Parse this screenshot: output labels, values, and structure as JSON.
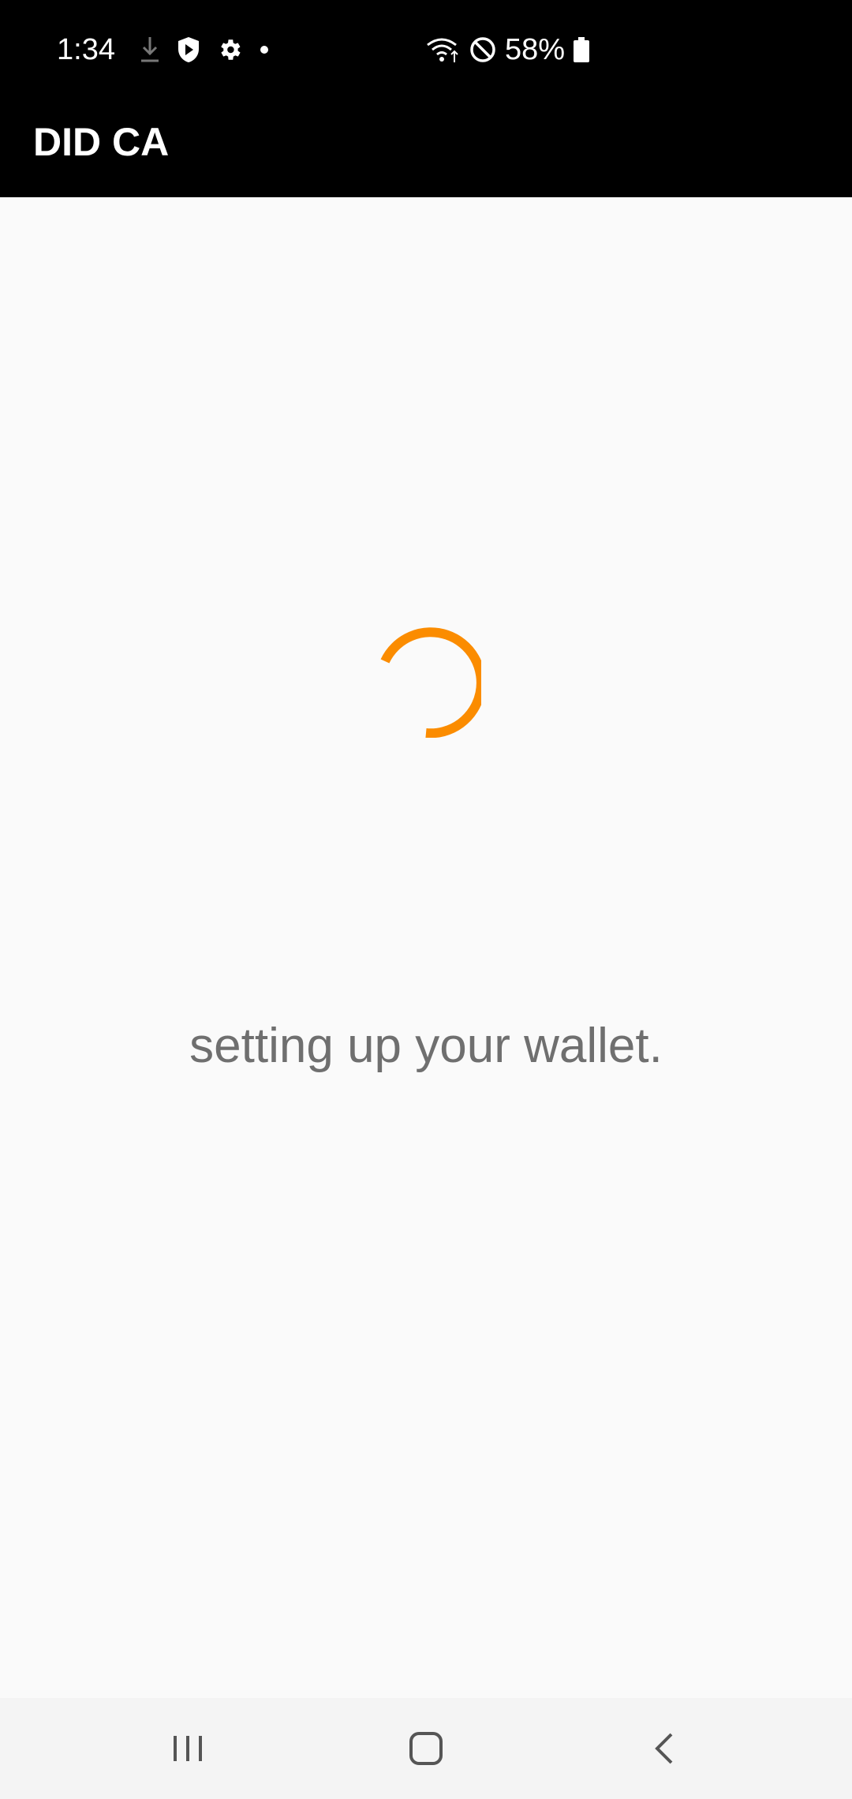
{
  "status_bar": {
    "time": "1:34",
    "battery_percent": "58%",
    "icons_left": [
      "download-icon",
      "shield-play-icon",
      "gear-icon",
      "dot-icon"
    ],
    "icons_right": [
      "wifi-icon",
      "do-not-disturb-icon",
      "battery-icon"
    ]
  },
  "app_bar": {
    "title": "DID CA"
  },
  "main": {
    "loading_message": "setting up your wallet.",
    "spinner_color": "#fb8c00"
  },
  "nav_bar": {
    "buttons": [
      "recent-apps",
      "home",
      "back"
    ]
  }
}
